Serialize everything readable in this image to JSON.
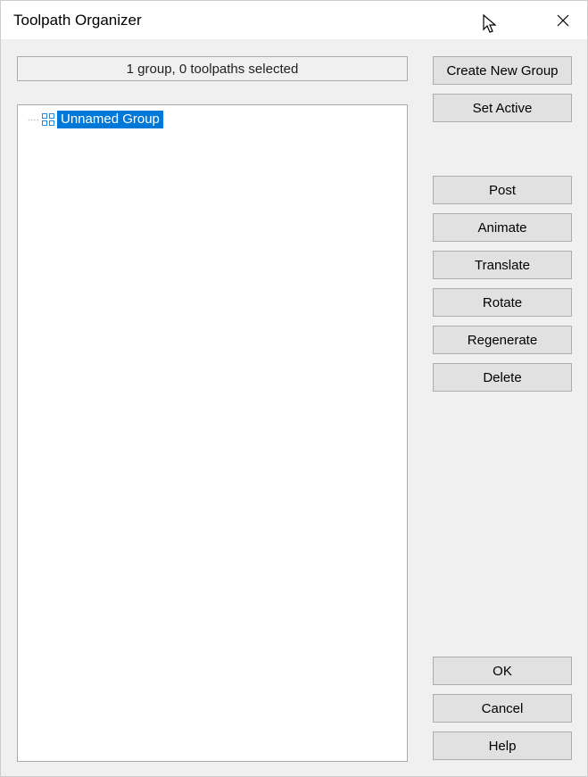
{
  "window": {
    "title": "Toolpath Organizer"
  },
  "status": "1 group, 0 toolpaths selected",
  "tree": {
    "items": [
      {
        "label": "Unnamed Group",
        "selected": true
      }
    ]
  },
  "buttons": {
    "create_group": "Create New Group",
    "set_active": "Set Active",
    "post": "Post",
    "animate": "Animate",
    "translate": "Translate",
    "rotate": "Rotate",
    "regenerate": "Regenerate",
    "delete": "Delete",
    "ok": "OK",
    "cancel": "Cancel",
    "help": "Help"
  }
}
